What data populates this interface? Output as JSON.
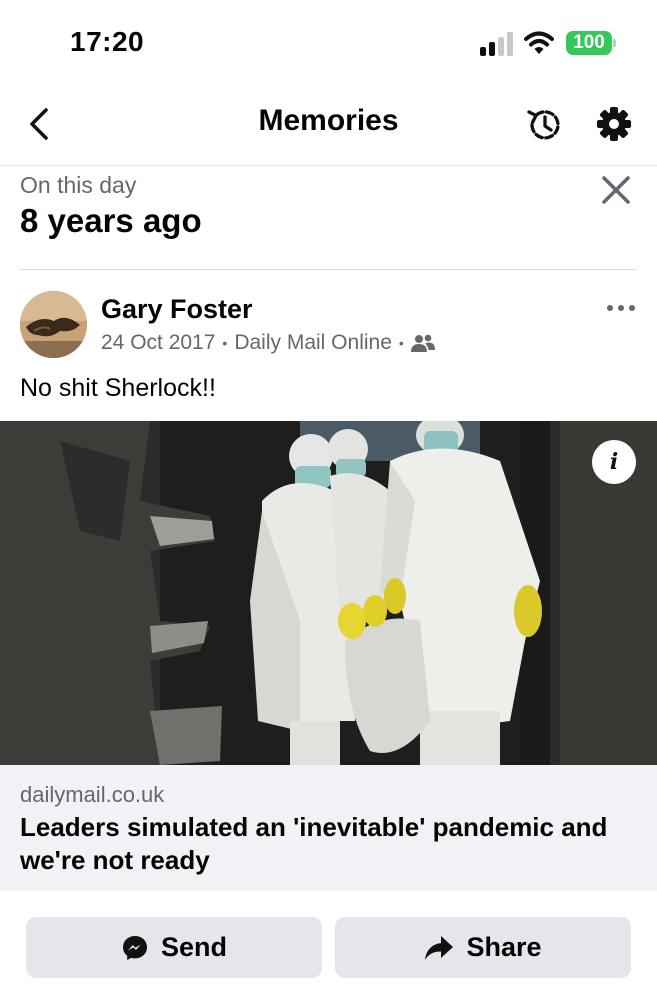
{
  "status_bar": {
    "time": "17:20",
    "battery": "100"
  },
  "nav": {
    "title": "Memories"
  },
  "memory": {
    "subtitle": "On this day",
    "title": "8 years ago"
  },
  "post": {
    "author": "Gary Foster",
    "date": "24 Oct 2017",
    "source": "Daily Mail Online",
    "audience_icon": "friends-icon",
    "text": "No shit Sherlock!!"
  },
  "link": {
    "domain": "dailymail.co.uk",
    "title": "Leaders simulated an 'inevitable' pandemic and we're not ready",
    "info_glyph": "i"
  },
  "actions": {
    "send": "Send",
    "share": "Share"
  },
  "colors": {
    "accent_battery": "#34c759",
    "secondary_text": "#65676b",
    "button_bg": "#e4e6eb",
    "link_bg": "#f0f2f5"
  }
}
